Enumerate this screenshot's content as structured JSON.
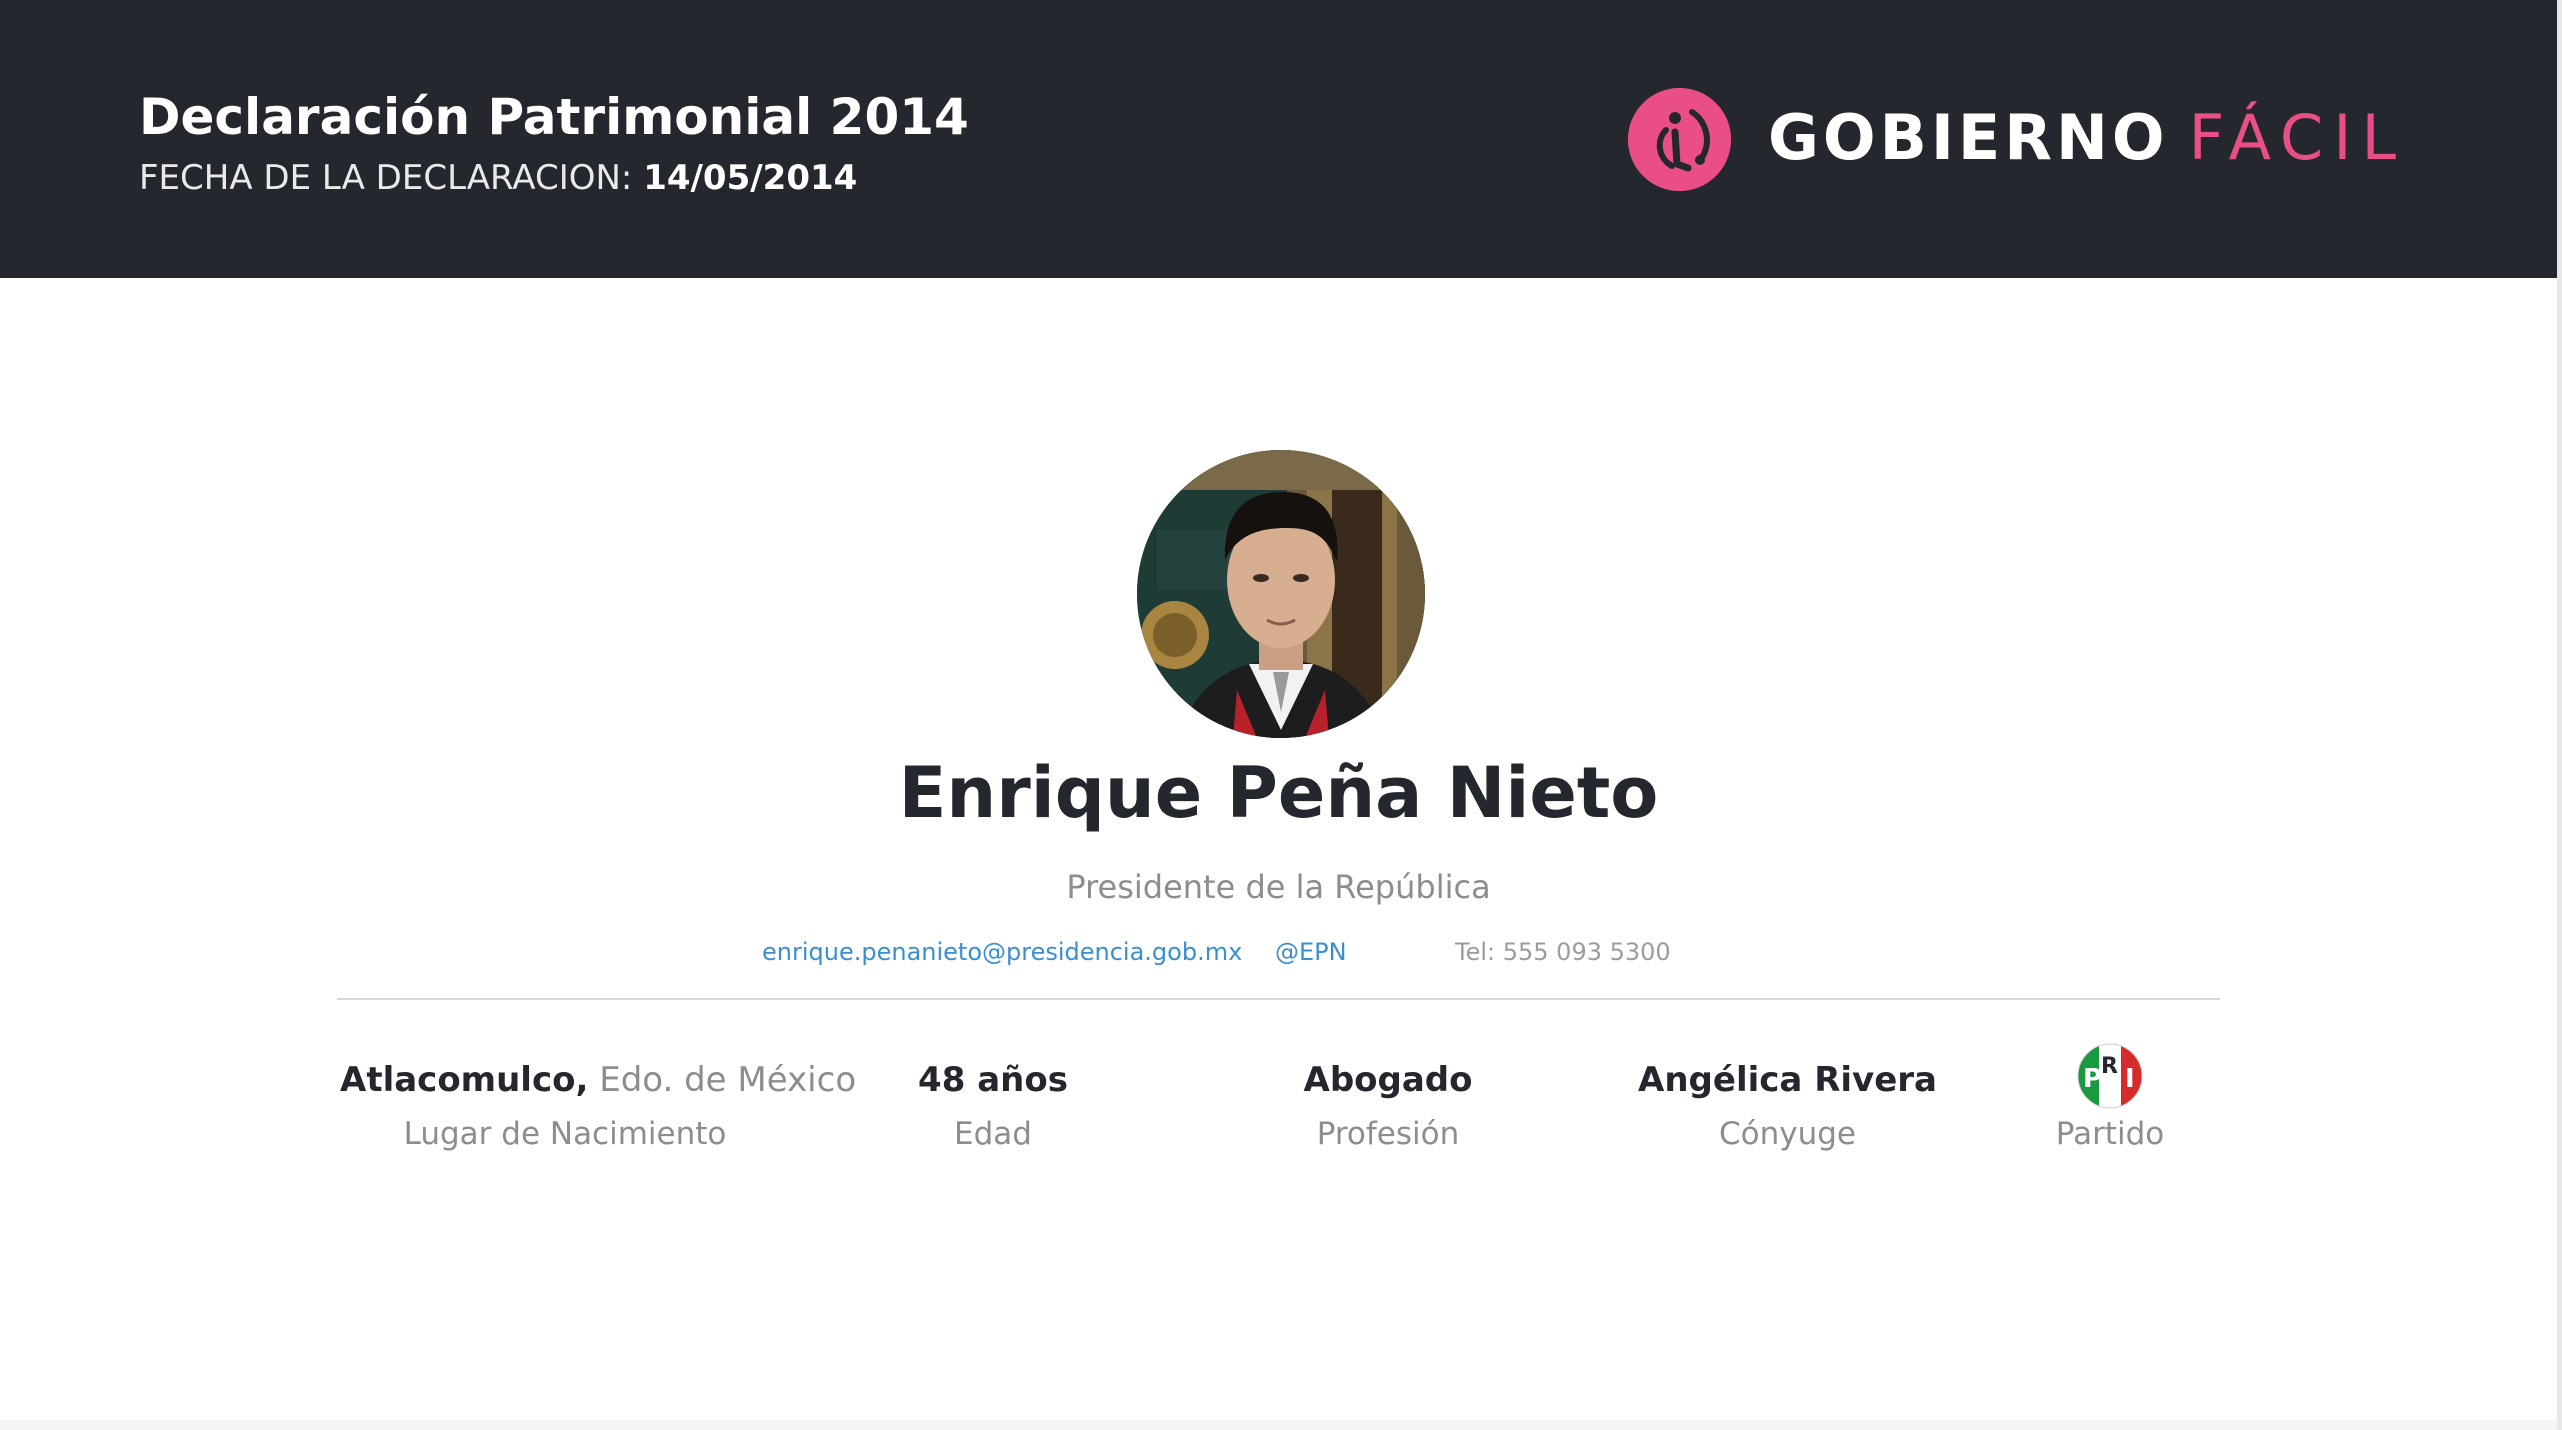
{
  "header": {
    "title": "Declaración Patrimonial 2014",
    "date_label": "FECHA DE LA DECLARACION:",
    "date_value": "14/05/2014",
    "logo": {
      "word1": "GOBIERNO",
      "word2": "FÁCIL",
      "icon": "gobierno-facil-logo-icon",
      "accent_color": "#e94e86"
    },
    "background_color": "#25272e"
  },
  "profile": {
    "photo": "portrait-photo",
    "name": "Enrique Peña Nieto",
    "role": "Presidente de la República",
    "email": "enrique.penanieto@presidencia.gob.mx",
    "twitter": "@EPN",
    "phone": "Tel: 555 093 5300"
  },
  "stats": [
    {
      "value_bold": "Atlacomulco,",
      "value_light": "Edo. de México",
      "label": "Lugar de Nacimiento"
    },
    {
      "value_bold": "48 años",
      "label": "Edad"
    },
    {
      "value_bold": "Abogado",
      "label": "Profesión"
    },
    {
      "value_bold": "Angélica Rivera",
      "label": "Cónyuge"
    },
    {
      "icon": "pri-party-logo-icon",
      "label": "Partido"
    }
  ]
}
